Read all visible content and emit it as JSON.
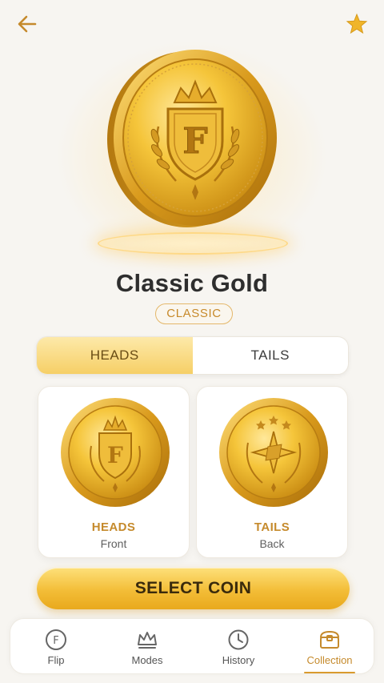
{
  "header": {
    "back_icon": "arrow-left-icon",
    "favorite_icon": "star-icon"
  },
  "coin": {
    "name": "Classic Gold",
    "tier": "CLASSIC"
  },
  "face_toggle": {
    "options": [
      "HEADS",
      "TAILS"
    ],
    "selected": "HEADS"
  },
  "faces": [
    {
      "label": "HEADS",
      "sub": "Front",
      "emblem": "crest-f-icon"
    },
    {
      "label": "TAILS",
      "sub": "Back",
      "emblem": "star-compass-icon"
    }
  ],
  "select_button": {
    "label": "SELECT COIN"
  },
  "nav": {
    "items": [
      {
        "label": "Flip",
        "icon": "coin-f-icon"
      },
      {
        "label": "Modes",
        "icon": "crown-icon"
      },
      {
        "label": "History",
        "icon": "clock-icon"
      },
      {
        "label": "Collection",
        "icon": "chest-icon"
      }
    ],
    "active": "Collection"
  },
  "colors": {
    "accent": "#c58a2c",
    "gold": "#f3bd37",
    "background": "#f7f5f1"
  }
}
